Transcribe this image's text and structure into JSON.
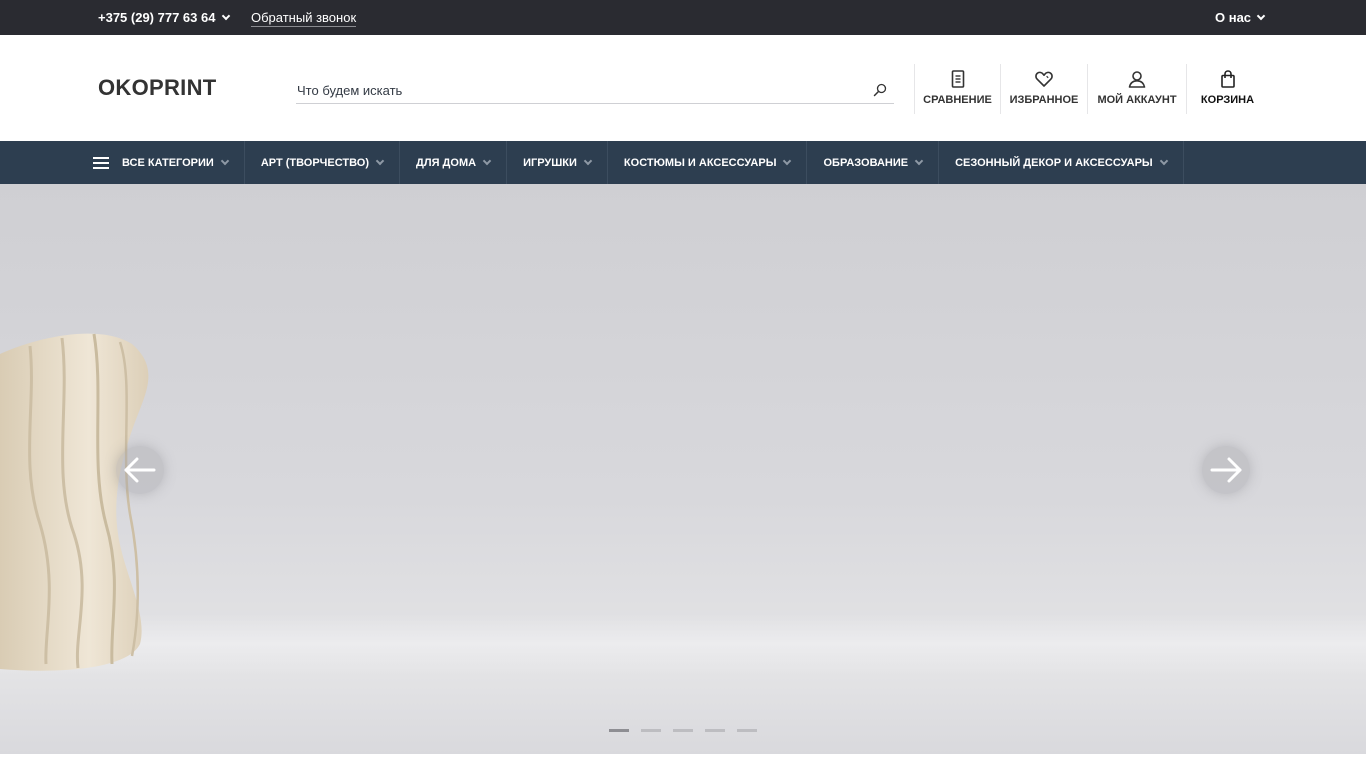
{
  "topbar": {
    "phone": "+375 (29) 777 63 64",
    "callback": "Обратный звонок",
    "about": "О нас"
  },
  "header": {
    "logo": "OKOPRINT",
    "search_placeholder": "Что будем искать",
    "items": [
      {
        "label": "Сравнение",
        "icon": "compare-icon"
      },
      {
        "label": "Избранное",
        "icon": "heart-icon"
      },
      {
        "label": "Мой аккаунт",
        "icon": "user-icon"
      },
      {
        "label": "Корзина",
        "icon": "bag-icon"
      }
    ]
  },
  "nav": {
    "all_categories": "Все категории",
    "items": [
      "Арт (творчество)",
      "Для дома",
      "Игрушки",
      "Костюмы и аксессуары",
      "Образование",
      "Сезонный декор и аксессуары"
    ]
  },
  "hero": {
    "slides_count": 5,
    "active_slide": 1
  },
  "colors": {
    "topbar_bg": "#2a2b31",
    "nav_bg": "#2d3e50"
  }
}
